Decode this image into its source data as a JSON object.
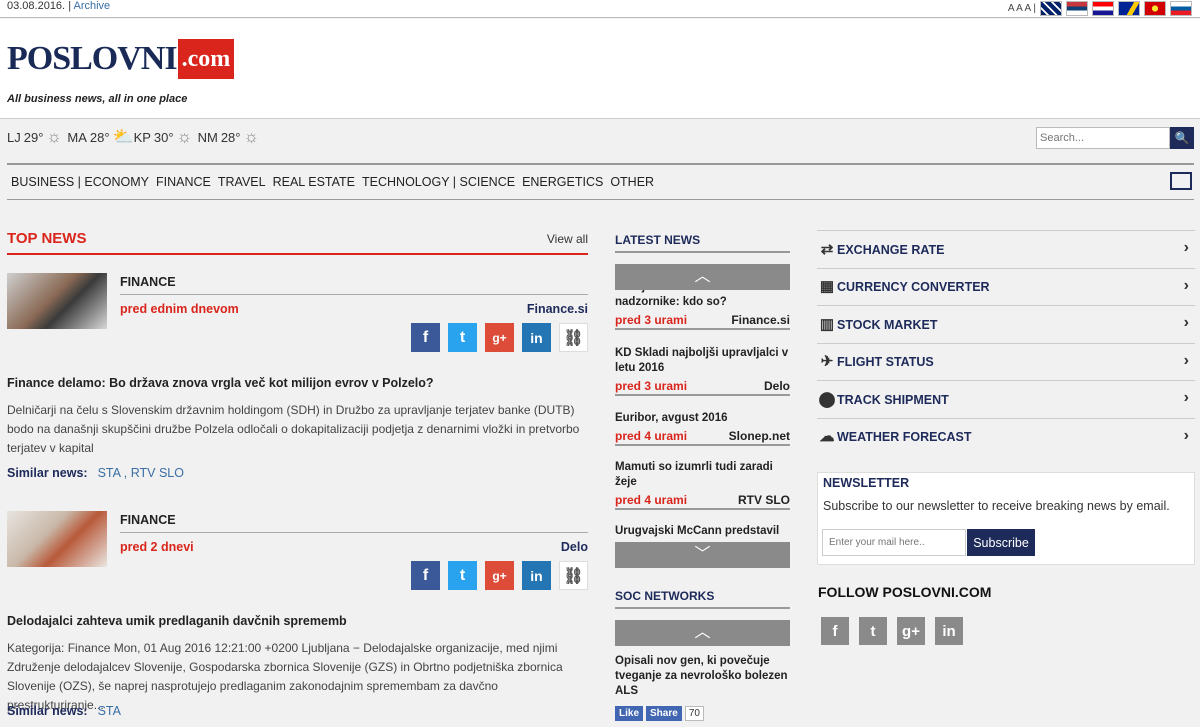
{
  "topbar": {
    "date": "03.08.2016.",
    "sep": "|",
    "archive": "Archive",
    "font_sizes": "A A A |",
    "flags": [
      "gb",
      "rs",
      "hr",
      "ba",
      "mk",
      "si"
    ]
  },
  "header": {
    "logo_main": "POSLOVNI",
    "logo_suffix": ".com",
    "tagline": "All business news, all in one place"
  },
  "weather": [
    {
      "city": "LJ",
      "temp": "29°",
      "icon": "sun-icon"
    },
    {
      "city": "MA",
      "temp": "28°",
      "icon": "partly-cloudy-icon"
    },
    {
      "city": "KP",
      "temp": "30°",
      "icon": "sun-icon"
    },
    {
      "city": "NM",
      "temp": "28°",
      "icon": "sun-icon"
    }
  ],
  "search": {
    "placeholder": "Search..."
  },
  "nav": [
    "BUSINESS | ECONOMY",
    "FINANCE",
    "TRAVEL",
    "REAL ESTATE",
    "TECHNOLOGY | SCIENCE",
    "ENERGETICS",
    "OTHER"
  ],
  "top_news": {
    "title": "TOP NEWS",
    "view_all": "View all",
    "articles": [
      {
        "category": "FINANCE",
        "age": "pred ednim dnevom",
        "source": "Finance.si",
        "headline": "Finance delamo: Bo država znova vrgla več kot milijon evrov v Polzelo?",
        "body": "Delničarji na čelu s Slovenskim državnim holdingom (SDH) in Družbo za upravljanje terjatev banke (DUTB) bodo na današnji skupščini družbe Polzela odločali o dokapitalizaciji podjetja z denarnimi vložki in pretvorbo terjatev v kapital",
        "similar_label": "Similar news:",
        "similar": "STA , RTV SLO"
      },
      {
        "category": "FINANCE",
        "age": "pred 2 dnevi",
        "source": "Delo",
        "headline": "Delodajalci zahteva umik predlaganih davčnih sprememb",
        "body": "Kategorija: Finance Mon, 01 Aug 2016 12:21:00 +0200 Ljubljana − Delodajalske organizacije, med njimi Združenje delodajalcev Slovenije, Gospodarska zbornica Slovenije (GZS) in Obrtno podjetniška zbornica Slovenije (OZS), še naprej nasprotujejo predlaganim zakonodajnim spremembam za davčno prestrukturiranje...",
        "similar_label": "Similar news:",
        "similar": "STA"
      }
    ]
  },
  "latest": {
    "title": "LATEST NEWS",
    "items": [
      {
        "title": "NLB jutri dobi štiri nove nadzornike: kdo so?",
        "age": "pred 3 urami",
        "source": "Finance.si"
      },
      {
        "title": "KD Skladi najboljši upravljalci v letu 2016",
        "age": "pred 3 urami",
        "source": "Delo"
      },
      {
        "title": "Euribor, avgust 2016",
        "age": "pred 4 urami",
        "source": "Slonep.net"
      },
      {
        "title": "Mamuti so izumrli tudi zaradi žeje",
        "age": "pred 4 urami",
        "source": "RTV SLO"
      },
      {
        "title": "Urugvajski McCann predstavil",
        "age": "",
        "source": ""
      }
    ]
  },
  "soc": {
    "title": "SOC NETWORKS",
    "item": "Opisali nov gen, ki povečuje tveganje za nevrološko bolezen ALS",
    "like": "Like",
    "share": "Share",
    "count": "70"
  },
  "tools": [
    {
      "label": "EXCHANGE RATE",
      "icon": "exchange-icon"
    },
    {
      "label": "CURRENCY CONVERTER",
      "icon": "calculator-icon"
    },
    {
      "label": "STOCK MARKET",
      "icon": "chart-icon"
    },
    {
      "label": "FLIGHT STATUS",
      "icon": "plane-icon"
    },
    {
      "label": "TRACK SHIPMENT",
      "icon": "pin-icon"
    },
    {
      "label": "WEATHER FORECAST",
      "icon": "cloud-icon"
    }
  ],
  "newsletter": {
    "title": "NEWSLETTER",
    "desc": "Subscribe to our newsletter to receive breaking news by email.",
    "placeholder": "Enter your mail here..",
    "button": "Subscribe"
  },
  "follow": {
    "title": "FOLLOW POSLOVNI.COM",
    "icons": [
      "f",
      "t",
      "g+",
      "in"
    ]
  },
  "share_glyphs": {
    "fb": "f",
    "tw": "t",
    "gp": "g+",
    "li": "in",
    "ln": "⛓"
  }
}
